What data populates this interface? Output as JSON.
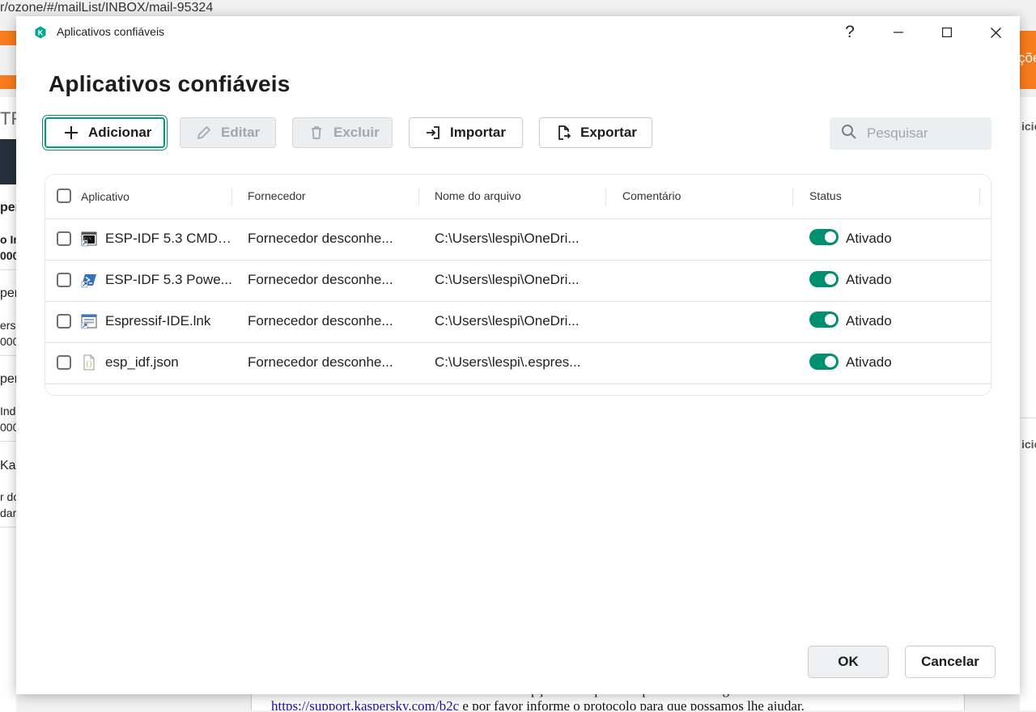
{
  "background": {
    "url": "r/ozone/#/mailList/INBOX/mail-95324",
    "right_top_text": "ções",
    "left_fragments": [
      "TR",
      "per",
      "o In",
      "000",
      "pers",
      "ers",
      "000",
      "pers",
      "Ind",
      "000",
      "Kas",
      "r do",
      "dard"
    ],
    "right_fragments": [
      "icic",
      "icic"
    ],
    "bottom_line1": "contate imediatamente usando uma de nossas opções de suporte disponíveis de Segunda a Sexta-feira.",
    "bottom_link": "https://support.kaspersky.com/b2c",
    "bottom_line2_rest": " e por favor informe o protocolo para que possamos lhe ajudar."
  },
  "window": {
    "title": "Aplicativos confiáveis",
    "icon": "kaspersky-shield-icon",
    "help_label": "?",
    "controls": [
      "minimize-icon",
      "maximize-icon",
      "close-icon"
    ]
  },
  "page": {
    "heading": "Aplicativos confiáveis"
  },
  "toolbar": {
    "add_label": "Adicionar",
    "edit_label": "Editar",
    "delete_label": "Excluir",
    "import_label": "Importar",
    "export_label": "Exportar",
    "search_placeholder": "Pesquisar"
  },
  "table": {
    "columns": [
      "Aplicativo",
      "Fornecedor",
      "Nome do arquivo",
      "Comentário",
      "Status"
    ],
    "rows": [
      {
        "app": "ESP-IDF 5.3 CMD.l...",
        "icon": "cmd-shortcut-icon",
        "vendor": "Fornecedor desconhe...",
        "file": "C:\\Users\\lespi\\OneDri...",
        "comment": "",
        "status": "Ativado",
        "enabled": true
      },
      {
        "app": "ESP-IDF 5.3 Powe...",
        "icon": "powershell-shortcut-icon",
        "vendor": "Fornecedor desconhe...",
        "file": "C:\\Users\\lespi\\OneDri...",
        "comment": "",
        "status": "Ativado",
        "enabled": true
      },
      {
        "app": "Espressif-IDE.lnk",
        "icon": "app-shortcut-icon",
        "vendor": "Fornecedor desconhe...",
        "file": "C:\\Users\\lespi\\OneDri...",
        "comment": "",
        "status": "Ativado",
        "enabled": true
      },
      {
        "app": "esp_idf.json",
        "icon": "json-file-icon",
        "vendor": "Fornecedor desconhe...",
        "file": "C:\\Users\\lespi\\.espres...",
        "comment": "",
        "status": "Ativado",
        "enabled": true
      }
    ]
  },
  "footer": {
    "ok_label": "OK",
    "cancel_label": "Cancelar"
  },
  "colors": {
    "accent": "#00906f",
    "focus_border": "#009a7d",
    "browser_orange": "#f97c1e"
  }
}
